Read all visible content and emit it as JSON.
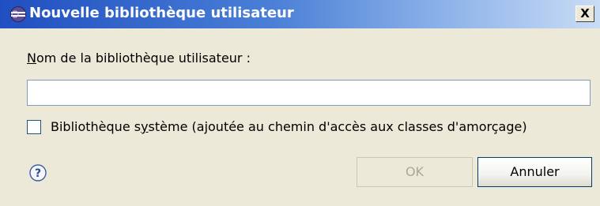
{
  "window": {
    "title": "Nouvelle bibliothèque utilisateur",
    "close_label": "X"
  },
  "form": {
    "name_label_mnemonic": "N",
    "name_label_rest": "om de la bibliothèque utilisateur :",
    "name_value": "",
    "system_checkbox_checked": false,
    "system_label_before": "Bibliothèque s",
    "system_label_mnemonic": "y",
    "system_label_after": "stème (ajoutée au chemin d'accès aux classes d'amorçage)"
  },
  "buttons": {
    "ok_label": "OK",
    "ok_enabled": false,
    "cancel_label": "Annuler"
  },
  "icons": {
    "title": "eclipse-icon",
    "help": "help-icon"
  },
  "colors": {
    "titlebar_start": "#1f4fc1",
    "titlebar_end": "#c9dcf5",
    "dialog_background": "#ece9d8",
    "disabled_text": "#aca899"
  }
}
